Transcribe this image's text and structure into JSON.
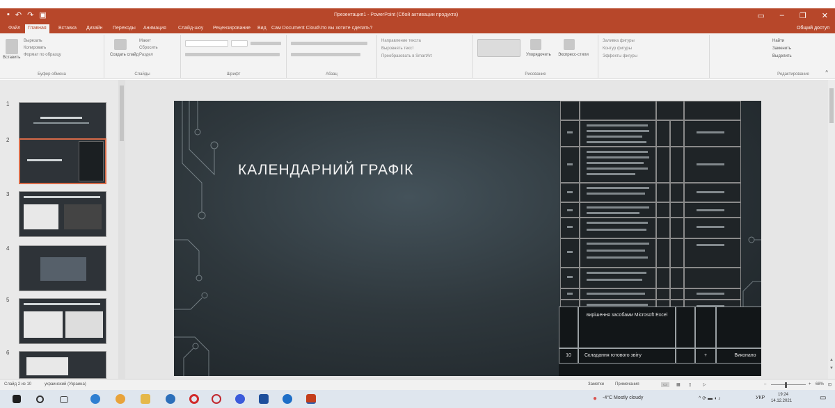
{
  "window": {
    "title": "Презентация1 - PowerPoint (Сбой активации продукта)",
    "minimize_icon": "minimize-icon",
    "restore_icon": "restore-icon",
    "close_icon": "close-icon"
  },
  "ribbon_tabs": {
    "file": "Файл",
    "home": "Главная",
    "insert": "Вставка",
    "design": "Дизайн",
    "transitions": "Переходы",
    "animations": "Анимация",
    "slideshow": "Слайд-шоу",
    "review": "Рецензирование",
    "view": "Вид",
    "document_cloud": "Сам Document Cloud",
    "tell_me": "Что вы хотите сделать?",
    "share": "Общий доступ"
  },
  "ribbon": {
    "paste": "Вставить",
    "cut": "Вырезать",
    "copy": "Копировать",
    "format_painter": "Формат по образцу",
    "clipboard": "Буфер обмена",
    "new_slide": "Создать слайд",
    "layout": "Макет",
    "reset": "Сбросить",
    "section": "Раздел",
    "slides": "Слайды",
    "font": "Шрифт",
    "paragraph": "Абзац",
    "text_direction": "Направление текста",
    "align_text": "Выровнять текст",
    "convert_smartart": "Преобразовать в SmartArt",
    "arrange": "Упорядочить",
    "quick_styles": "Экспресс-стили",
    "drawing": "Рисование",
    "shape_fill": "Заливка фигуры",
    "shape_outline": "Контур фигуры",
    "shape_effects": "Эффекты фигуры",
    "find": "Найти",
    "replace": "Заменить",
    "select": "Выделить",
    "editing": "Редактирование"
  },
  "thumbnails": [
    {
      "num": "1"
    },
    {
      "num": "2"
    },
    {
      "num": "3"
    },
    {
      "num": "4"
    },
    {
      "num": "5"
    },
    {
      "num": "6"
    }
  ],
  "slide": {
    "title": "КАЛЕНДАРНИЙ ГРАФІК",
    "table_row_text": "вирішення засобами Microsoft Excel",
    "table_row_num": "10",
    "table_row_task": "Складання готового звіту",
    "table_row_mark": "+",
    "table_row_status": "Виконано"
  },
  "status": {
    "slide_counter": "Слайд 2 из 10",
    "language": "украинский (Украина)",
    "notes": "Заметки",
    "comments": "Примечания",
    "zoom": "68%"
  },
  "taskbar": {
    "weather": "-4°C Mostly cloudy",
    "lang": "УКР",
    "time": "19:24",
    "date": "14.12.2021"
  }
}
